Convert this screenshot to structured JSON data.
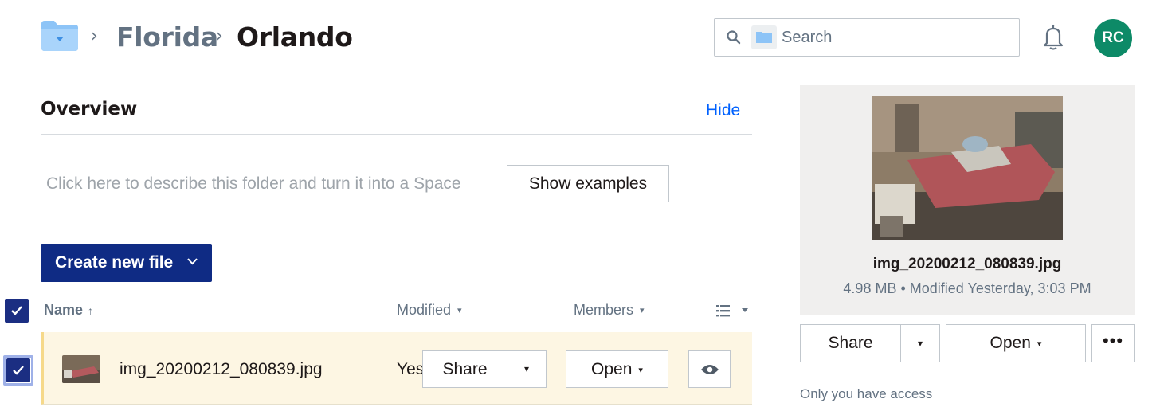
{
  "breadcrumb": {
    "root_icon": "folder-icon",
    "separator": "›",
    "items": [
      "Florida",
      "Orlando"
    ]
  },
  "search": {
    "placeholder": "Search",
    "value": ""
  },
  "user": {
    "initials": "RC",
    "avatar_color": "#0d8a67"
  },
  "overview": {
    "title": "Overview",
    "hide_label": "Hide",
    "describe_text": "Click here to describe this folder and turn it into a Space",
    "show_examples_label": "Show examples"
  },
  "toolbar": {
    "create_label": "Create new file",
    "create_color": "#0f2b84"
  },
  "table": {
    "columns": {
      "name": "Name",
      "name_sort": "↑",
      "modified": "Modified",
      "members": "Members"
    },
    "rows": [
      {
        "name": "img_20200212_080839.jpg",
        "modified": "Yes",
        "share_label": "Share",
        "open_label": "Open",
        "selected": true
      }
    ]
  },
  "preview": {
    "file_name": "img_20200212_080839.jpg",
    "meta": "4.98 MB • Modified Yesterday, 3:03 PM",
    "share_label": "Share",
    "open_label": "Open",
    "more_label": "•••",
    "access_text": "Only you have access"
  },
  "caret": "▾"
}
